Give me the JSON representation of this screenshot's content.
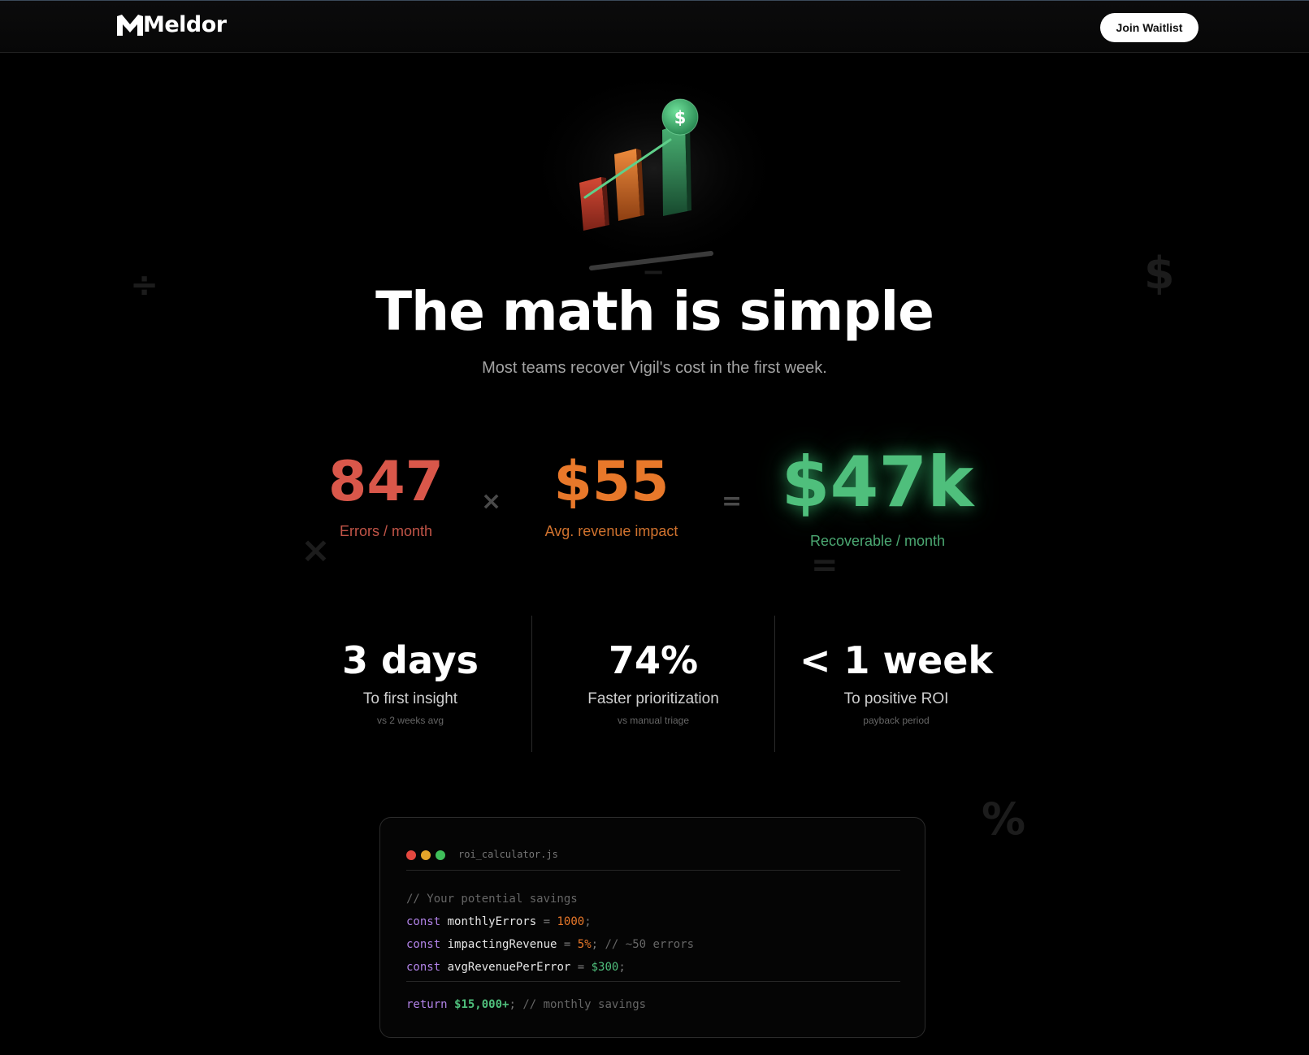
{
  "nav": {
    "brand": "Meldor",
    "cta_label": "Join Waitlist"
  },
  "decorations": {
    "divide": "÷",
    "dollar": "$",
    "times": "×",
    "equals": "=",
    "percent": "%",
    "minus": "−"
  },
  "hero": {
    "badge_symbol": "$",
    "title": "The math is simple",
    "subtitle": "Most teams recover Vigil's cost in the first week."
  },
  "equation": {
    "errors_value": "847",
    "errors_label": "Errors / month",
    "times_symbol": "×",
    "revenue_value": "$55",
    "revenue_label": "Avg. revenue impact",
    "equals_symbol": "=",
    "result_value": "$47k",
    "result_label": "Recoverable / month"
  },
  "stats": [
    {
      "value": "3 days",
      "label": "To first insight",
      "sub": "vs 2 weeks avg"
    },
    {
      "value": "74%",
      "label": "Faster prioritization",
      "sub": "vs manual triage"
    },
    {
      "value": "< 1 week",
      "label": "To positive ROI",
      "sub": "payback period"
    }
  ],
  "code_card": {
    "filename": "roi_calculator.js",
    "window_dot_colors": [
      "#e5483f",
      "#e4a52a",
      "#3fbf5a"
    ],
    "comment": "// Your potential savings",
    "lines": [
      {
        "kw": "const",
        "name": "monthlyErrors",
        "op": "=",
        "value": "1000",
        "end": ";",
        "comment": ""
      },
      {
        "kw": "const",
        "name": "impactingRevenue",
        "op": "=",
        "value": "5%",
        "end": ";",
        "comment": "// ~50 errors"
      },
      {
        "kw": "const",
        "name": "avgRevenuePerError",
        "op": "=",
        "value": "$300",
        "end": ";",
        "comment": ""
      }
    ],
    "return_kw": "return",
    "return_value": "$15,000+",
    "return_end": ";",
    "return_comment": "// monthly savings"
  },
  "colors": {
    "errors": "#d9574a",
    "revenue": "#e8782a",
    "result": "#4fbf7c",
    "keyword": "#b283e8"
  }
}
